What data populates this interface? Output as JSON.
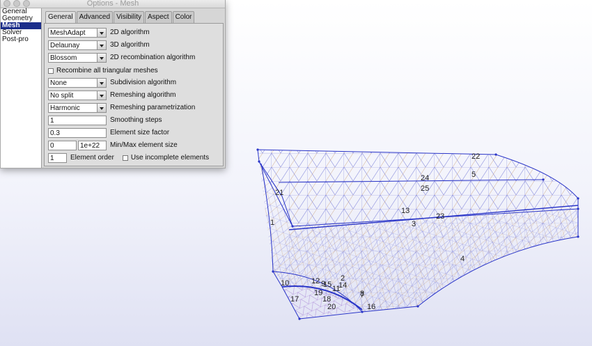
{
  "window": {
    "title": "Options - Mesh"
  },
  "nav": {
    "items": [
      "General",
      "Geometry",
      "Mesh",
      "Solver",
      "Post-pro"
    ],
    "selected": "Mesh"
  },
  "tabs": [
    "General",
    "Advanced",
    "Visibility",
    "Aspect",
    "Color"
  ],
  "active_tab": "General",
  "form": {
    "alg2d": {
      "value": "MeshAdapt",
      "label": "2D algorithm"
    },
    "alg3d": {
      "value": "Delaunay",
      "label": "3D algorithm"
    },
    "recomb_alg": {
      "value": "Blossom",
      "label": "2D recombination algorithm"
    },
    "recombine_all": {
      "label": "Recombine all triangular meshes",
      "checked": false
    },
    "subdivision": {
      "value": "None",
      "label": "Subdivision algorithm"
    },
    "remeshing": {
      "value": "No split",
      "label": "Remeshing algorithm"
    },
    "remesh_param": {
      "value": "Harmonic",
      "label": "Remeshing parametrization"
    },
    "smoothing": {
      "value": "1",
      "label": "Smoothing steps"
    },
    "size_factor": {
      "value": "0.3",
      "label": "Element size factor"
    },
    "min_size": "0",
    "max_size": "1e+22",
    "minmax_label": "Min/Max element size",
    "order": {
      "value": "1",
      "label": "Element order"
    },
    "incomplete": {
      "label": "Use incomplete elements",
      "checked": false
    }
  },
  "viewport": {
    "entity_labels": [
      "22",
      "5",
      "24",
      "25",
      "21",
      "13",
      "23",
      "3",
      "1",
      "4",
      "2",
      "12",
      "10",
      "15",
      "9",
      "14",
      "11",
      "19",
      "18",
      "7",
      "8",
      "17",
      "20",
      "16"
    ]
  },
  "colors": {
    "edge": "#2a35c8",
    "mesh_blue": "#7b7fd9",
    "mesh_orange": "#c89c72",
    "selection": "#1b2d8a"
  }
}
